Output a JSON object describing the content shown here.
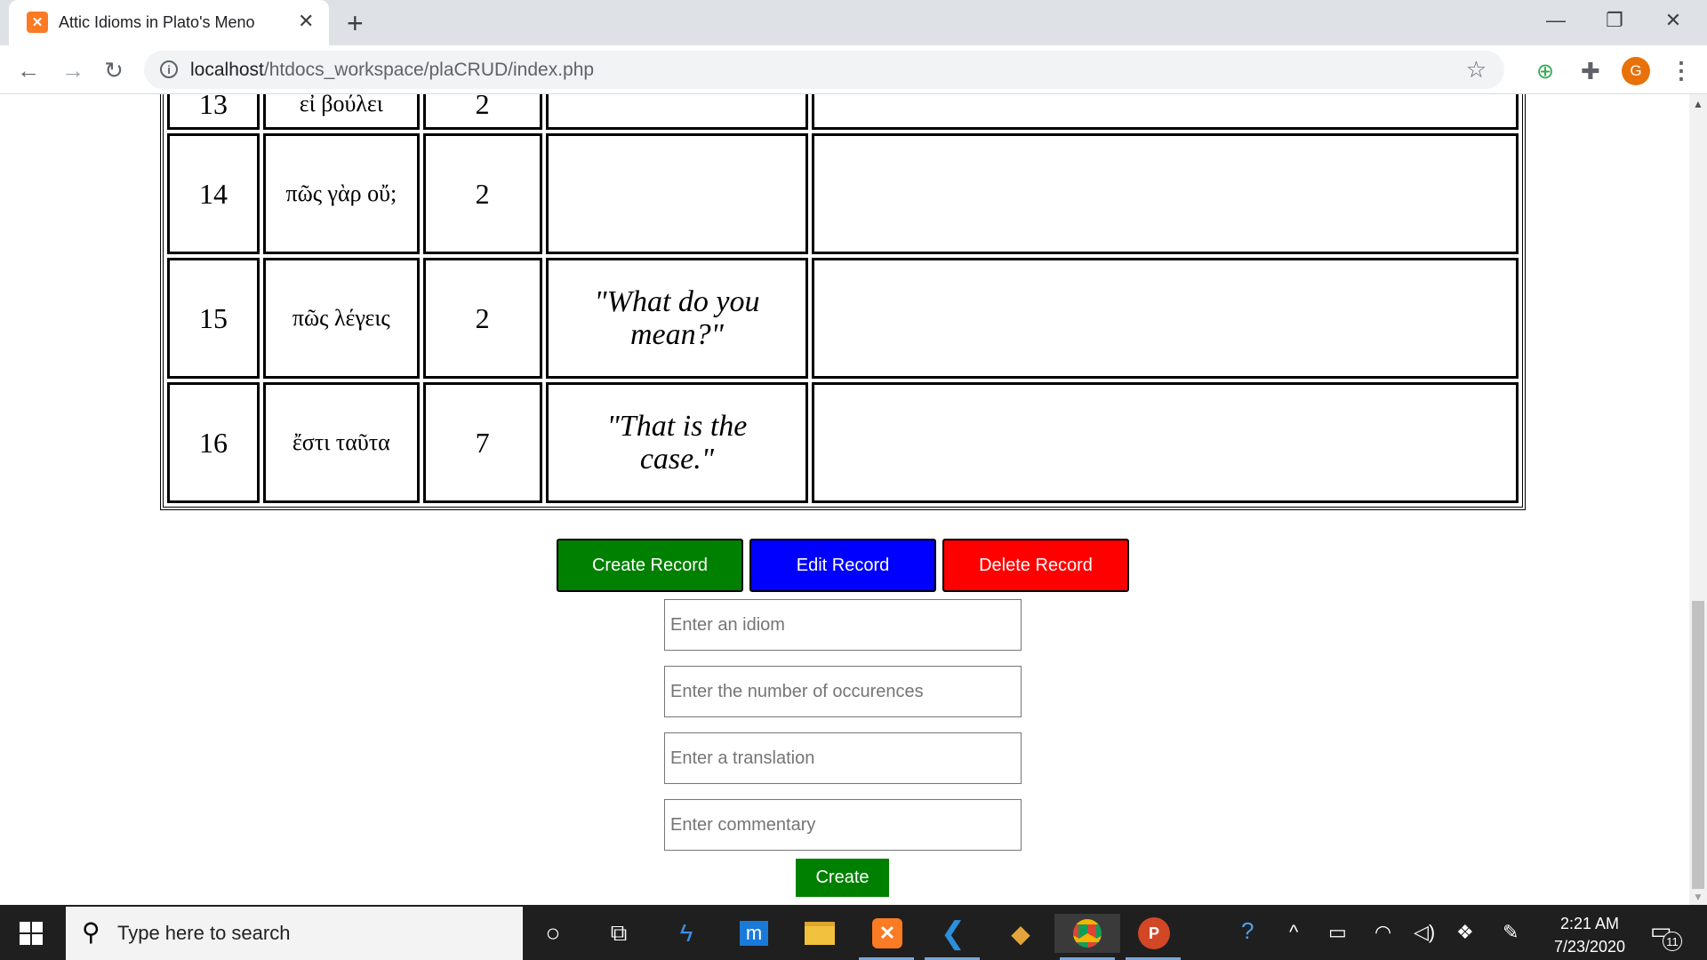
{
  "browser": {
    "tab_title": "Attic Idioms in Plato's Meno",
    "tab_close": "✕",
    "new_tab": "+",
    "window_controls": {
      "minimize": "—",
      "restore": "❐",
      "close": "✕"
    },
    "nav": {
      "back": "←",
      "forward": "→",
      "reload": "↻"
    },
    "url_host": "localhost",
    "url_path": "/htdocs_workspace/plaCRUD/index.php",
    "profile_initial": "G"
  },
  "table": {
    "partial_row": {
      "num": "13",
      "idiom": "εἰ βούλει",
      "occurrences": "2",
      "translation": "",
      "commentary": ""
    },
    "rows": [
      {
        "num": "14",
        "idiom": "πῶς γὰρ οὔ;",
        "occurrences": "2",
        "translation": "",
        "commentary": ""
      },
      {
        "num": "15",
        "idiom": "πῶς λέγεις",
        "occurrences": "2",
        "translation": "\"What do you mean?\"",
        "commentary": ""
      },
      {
        "num": "16",
        "idiom": "ἔστι ταῦτα",
        "occurrences": "7",
        "translation": "\"That is the case.\"",
        "commentary": ""
      }
    ]
  },
  "buttons": {
    "create": {
      "label": "Create Record",
      "color": "#008000"
    },
    "edit": {
      "label": "Edit Record",
      "color": "#0000ff"
    },
    "delete": {
      "label": "Delete Record",
      "color": "#ff0000"
    }
  },
  "form": {
    "idiom_placeholder": "Enter an idiom",
    "occurrences_placeholder": "Enter the number of occurences",
    "translation_placeholder": "Enter a translation",
    "commentary_placeholder": "Enter commentary",
    "submit_label": "Create"
  },
  "taskbar": {
    "search_placeholder": "Type here to search",
    "time": "2:21 AM",
    "date": "7/23/2020",
    "notification_count": "11"
  }
}
